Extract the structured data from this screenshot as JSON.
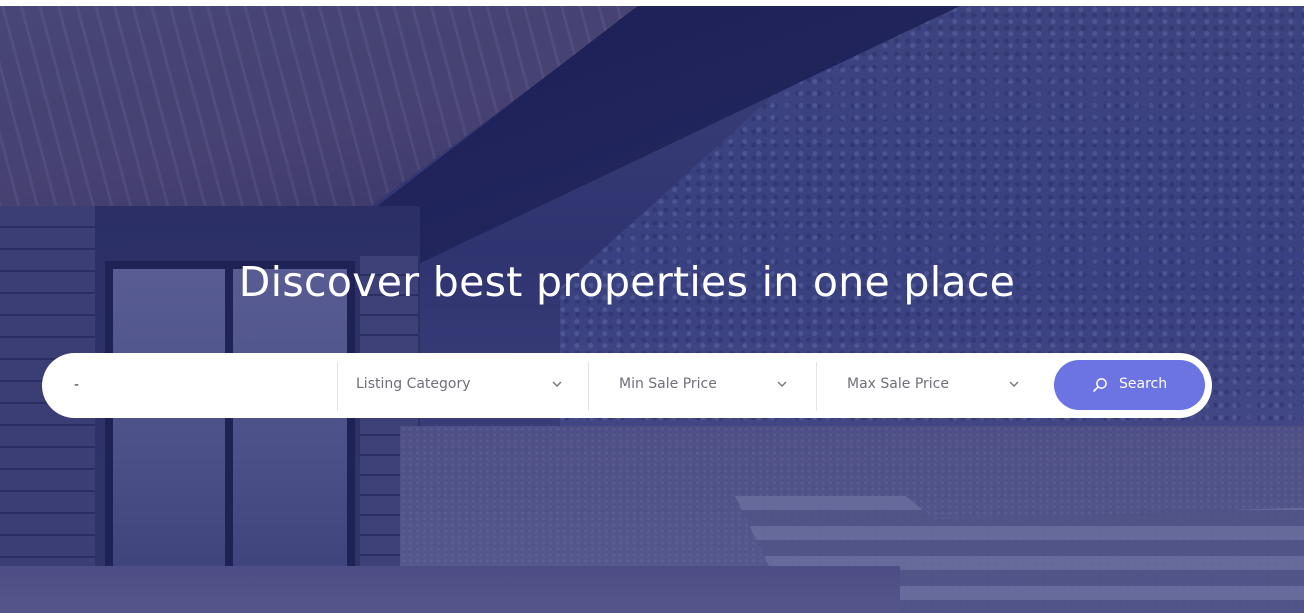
{
  "hero": {
    "headline": "Discover best properties in one place"
  },
  "search": {
    "keyword_value": "-",
    "category_label": "Listing Category",
    "min_price_label": "Min Sale Price",
    "max_price_label": "Max Sale Price",
    "button_label": "Search"
  },
  "colors": {
    "button": "#6c73e2",
    "overlay": "#2f3470"
  },
  "icons": {
    "dropdown": "chevron-down-icon",
    "search": "search-icon"
  }
}
